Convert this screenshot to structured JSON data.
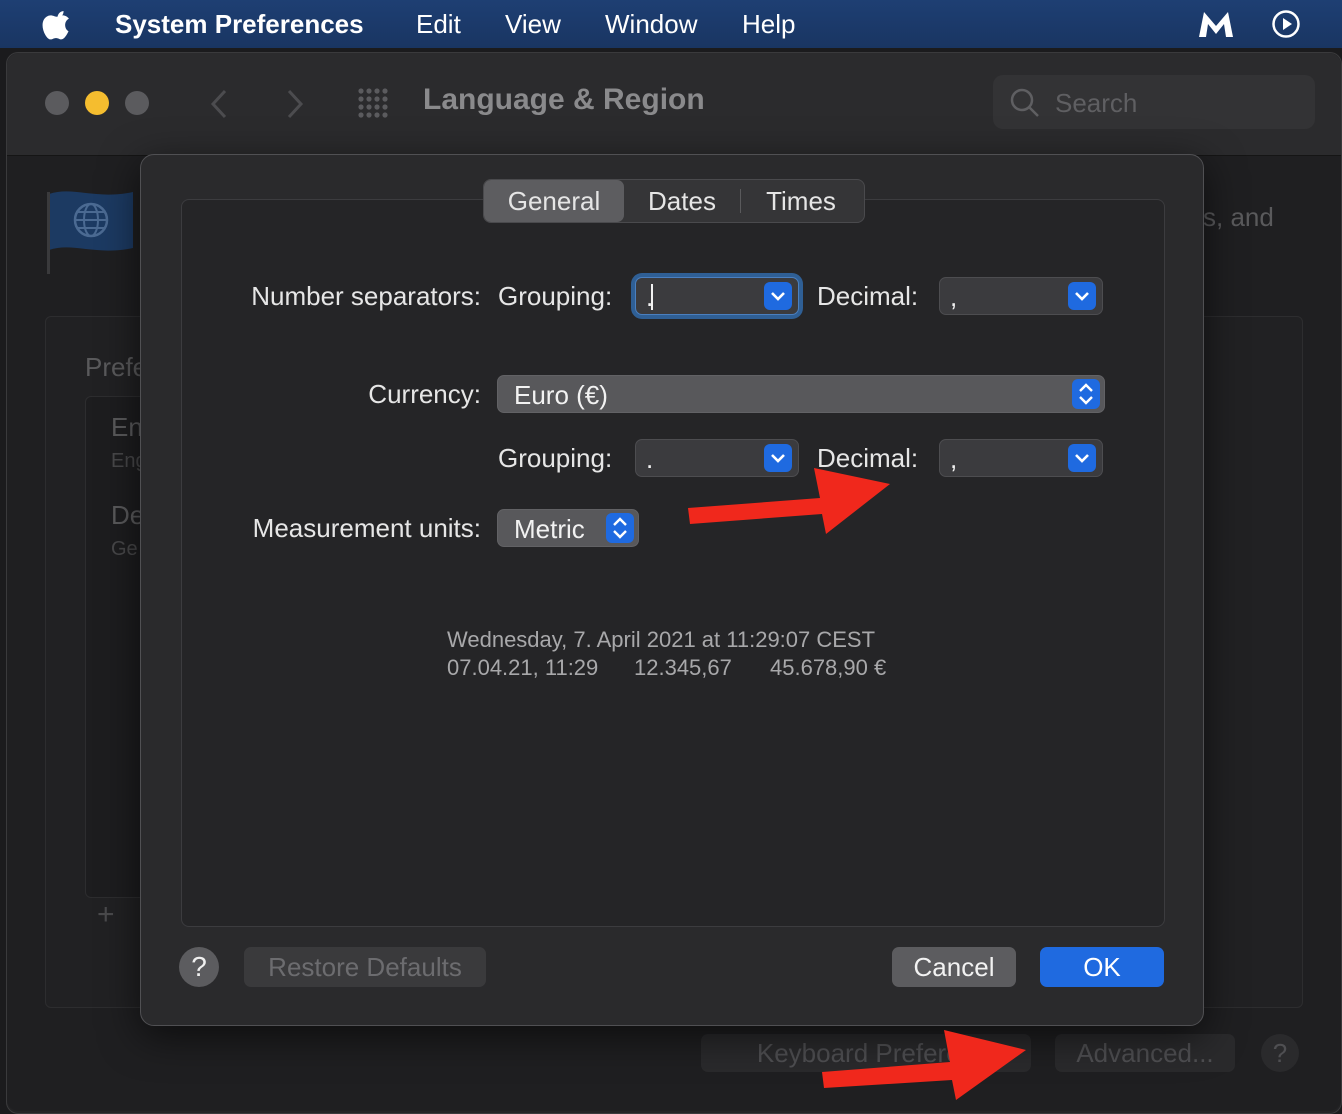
{
  "menubar": {
    "apple_icon": "apple-logo-icon",
    "app_name": "System Preferences",
    "items": [
      "Edit",
      "View",
      "Window",
      "Help"
    ],
    "status_icons": [
      "m-app-icon",
      "play-circle-icon"
    ]
  },
  "window": {
    "title": "Language & Region",
    "search_placeholder": "Search",
    "background": {
      "partial_text_right": "s, and",
      "panel_heading": "Prefe",
      "list_items": [
        {
          "title": "En",
          "subtitle": "Eng"
        },
        {
          "title": "De",
          "subtitle": "Ge"
        }
      ],
      "add_symbol": "+",
      "keyboard_button": "Keyboard Preferen",
      "advanced_button": "Advanced...",
      "help_symbol": "?"
    }
  },
  "sheet": {
    "tabs": [
      {
        "label": "General",
        "selected": true
      },
      {
        "label": "Dates",
        "selected": false
      },
      {
        "label": "Times",
        "selected": false
      }
    ],
    "number_separators_label": "Number separators:",
    "grouping_label": "Grouping:",
    "decimal_label": "Decimal:",
    "number_grouping_value": ".",
    "number_decimal_value": ",",
    "currency_label": "Currency:",
    "currency_value": "Euro (€)",
    "currency_grouping_label": "Grouping:",
    "currency_grouping_value": ".",
    "currency_decimal_label": "Decimal:",
    "currency_decimal_value": ",",
    "measurement_label": "Measurement units:",
    "measurement_value": "Metric",
    "sample_line1": "Wednesday, 7. April 2021 at 11:29:07 CEST",
    "sample_date": "07.04.21, 11:29",
    "sample_number": "12.345,67",
    "sample_currency": "45.678,90 €",
    "help_symbol": "?",
    "restore_defaults": "Restore Defaults",
    "cancel": "Cancel",
    "ok": "OK"
  },
  "colors": {
    "accent": "#1f6ae0",
    "annotation_arrow": "#f0281c"
  }
}
